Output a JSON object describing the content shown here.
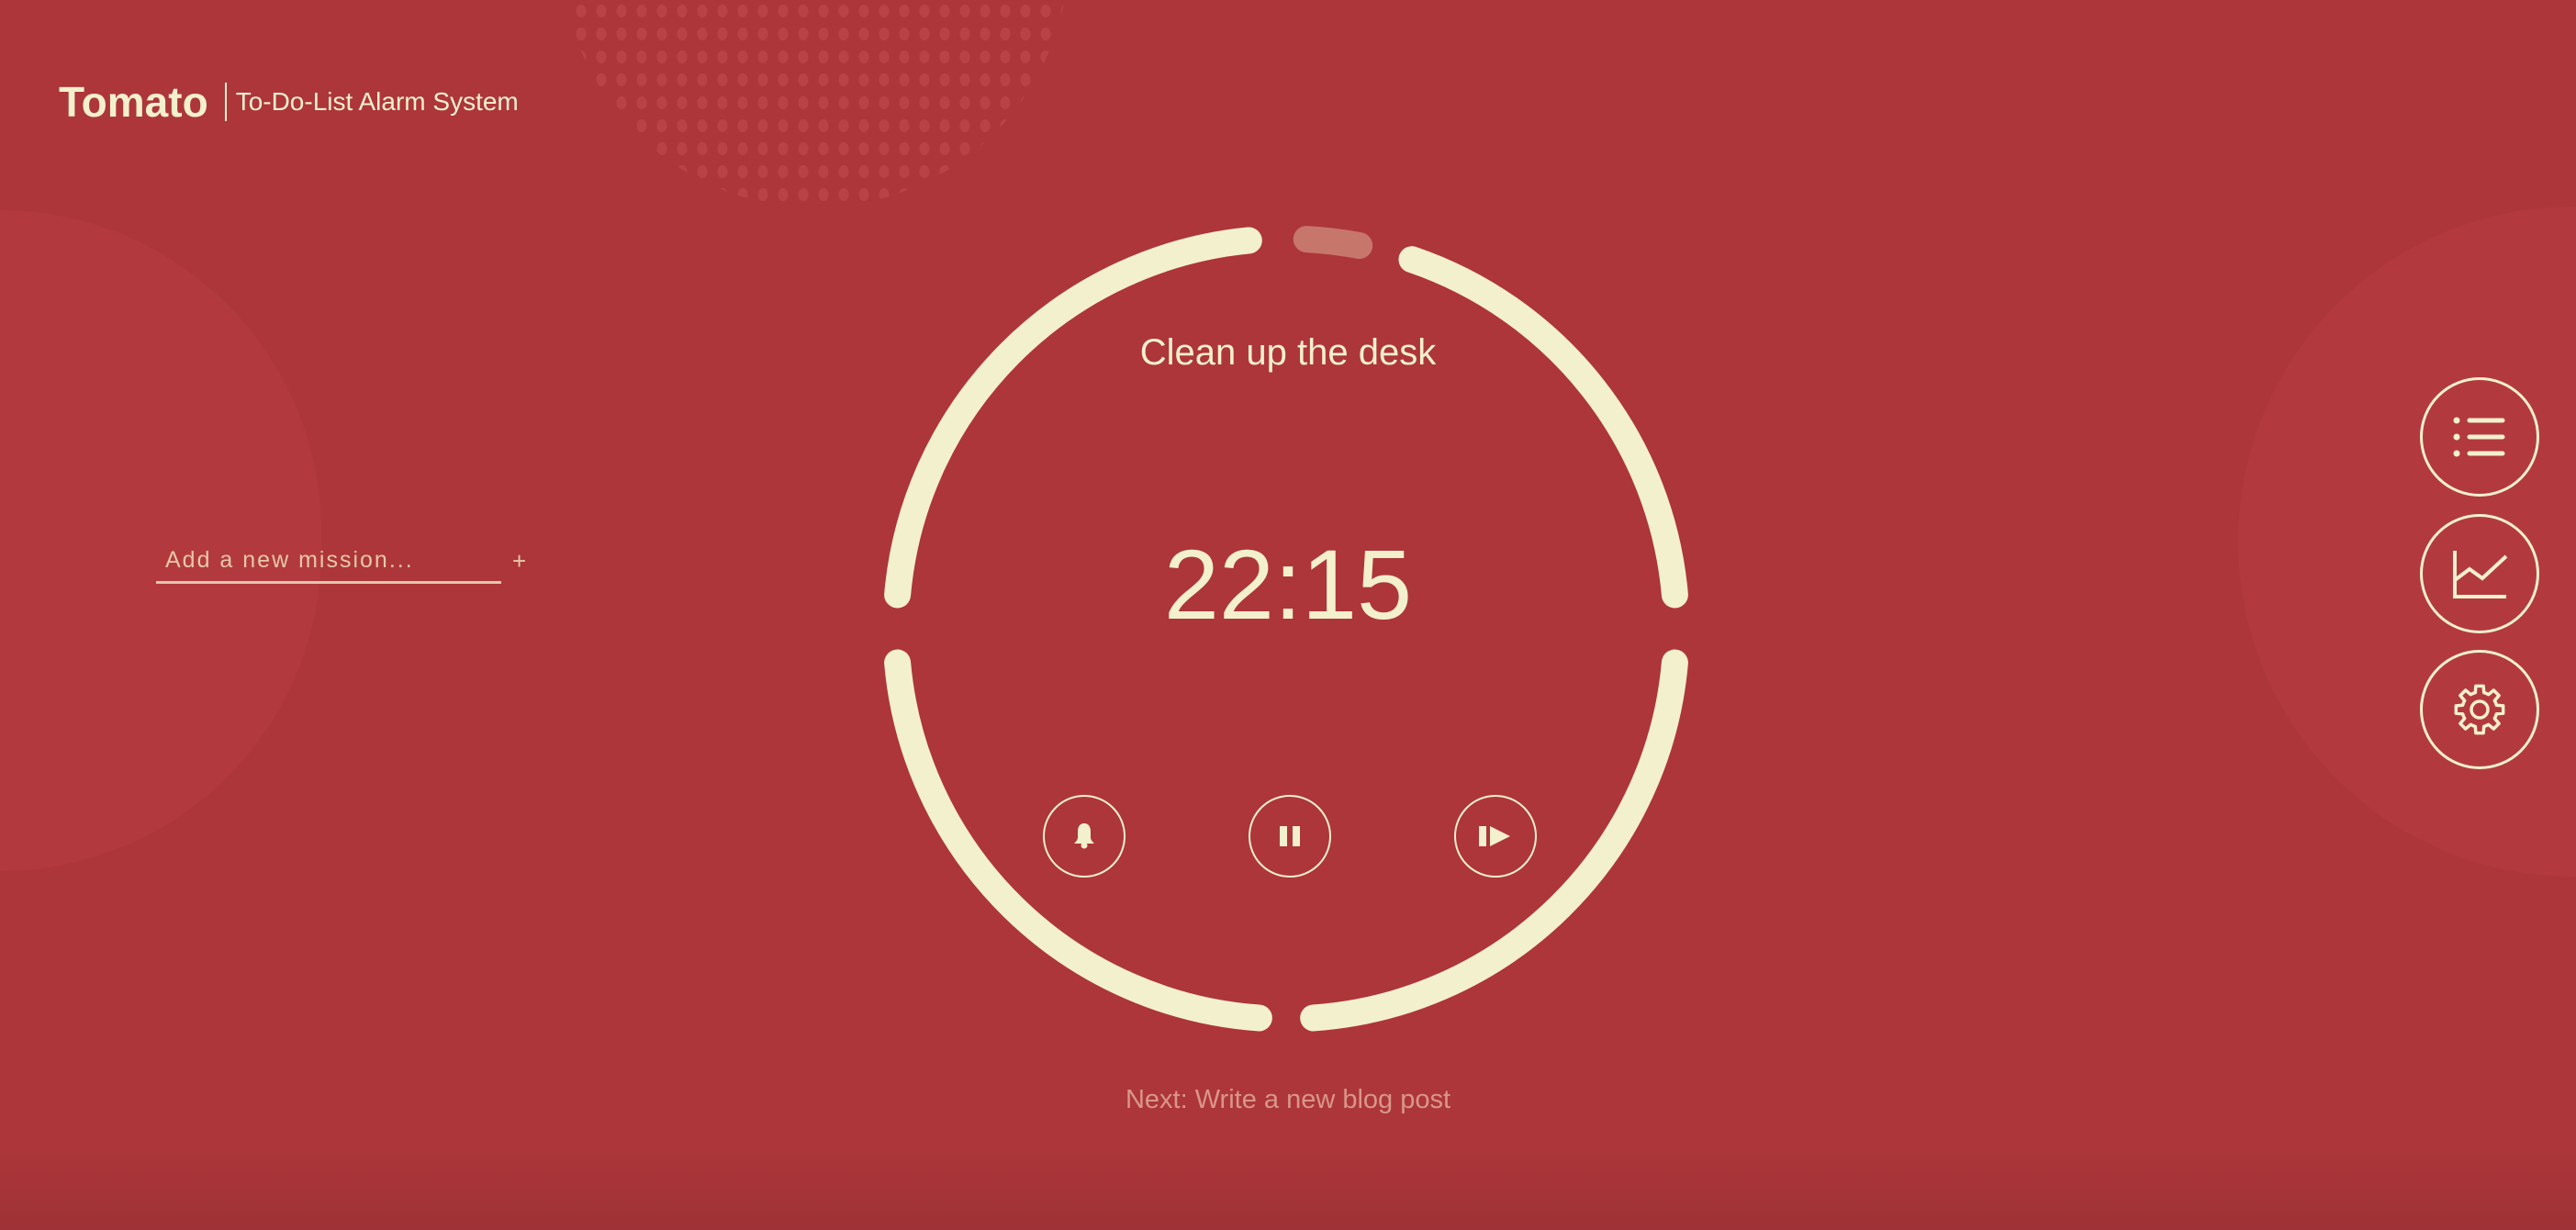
{
  "colors": {
    "background": "#ad363a",
    "accent": "#f3f0cd",
    "muted": "#d9968a"
  },
  "header": {
    "title": "Tomato",
    "subtitle": "To-Do-List Alarm System"
  },
  "mission_input": {
    "placeholder": "Add a new mission...",
    "value": "",
    "add_label": "+"
  },
  "timer": {
    "current_task": "Clean up the desk",
    "time_remaining": "22:15",
    "elapsed_fraction": 0.03,
    "controls": [
      {
        "name": "alarm",
        "icon": "bell-icon"
      },
      {
        "name": "pause",
        "icon": "pause-icon"
      },
      {
        "name": "skip",
        "icon": "skip-forward-icon"
      }
    ],
    "next_task": "Next: Write a new blog post"
  },
  "side_menu": [
    {
      "name": "task-list",
      "icon": "list-icon"
    },
    {
      "name": "statistics",
      "icon": "chart-icon"
    },
    {
      "name": "settings",
      "icon": "gear-icon"
    }
  ]
}
